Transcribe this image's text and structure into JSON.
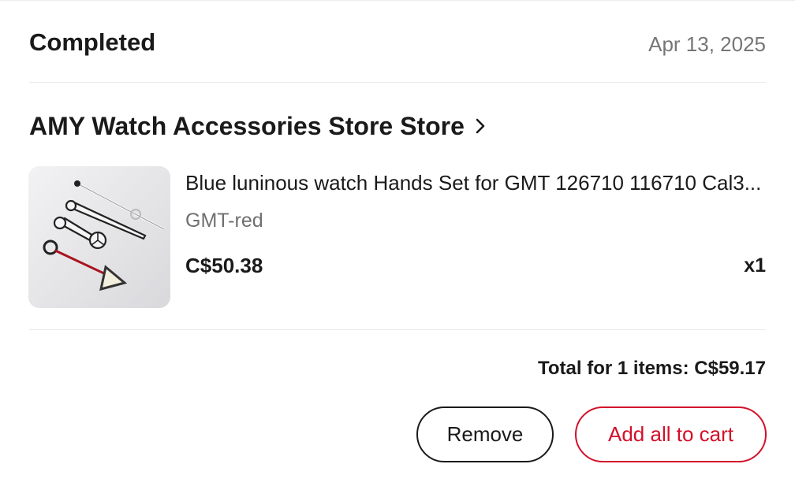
{
  "order": {
    "status": "Completed",
    "date": "Apr 13, 2025"
  },
  "store": {
    "name": "AMY Watch Accessories Store Store",
    "chevron_icon": "chevron-right-icon"
  },
  "item": {
    "image_icon": "watch-hands-product-image",
    "title": "Blue luninous watch Hands Set for GMT 126710 116710 Cal3...",
    "variant": "GMT-red",
    "price": "C$50.38",
    "quantity": "x1"
  },
  "summary": {
    "total": "Total for 1 items: C$59.17"
  },
  "actions": {
    "remove_label": "Remove",
    "add_all_label": "Add all to cart"
  },
  "colors": {
    "accent": "#d3102a",
    "text": "#1a1a1a",
    "muted": "#767676"
  }
}
